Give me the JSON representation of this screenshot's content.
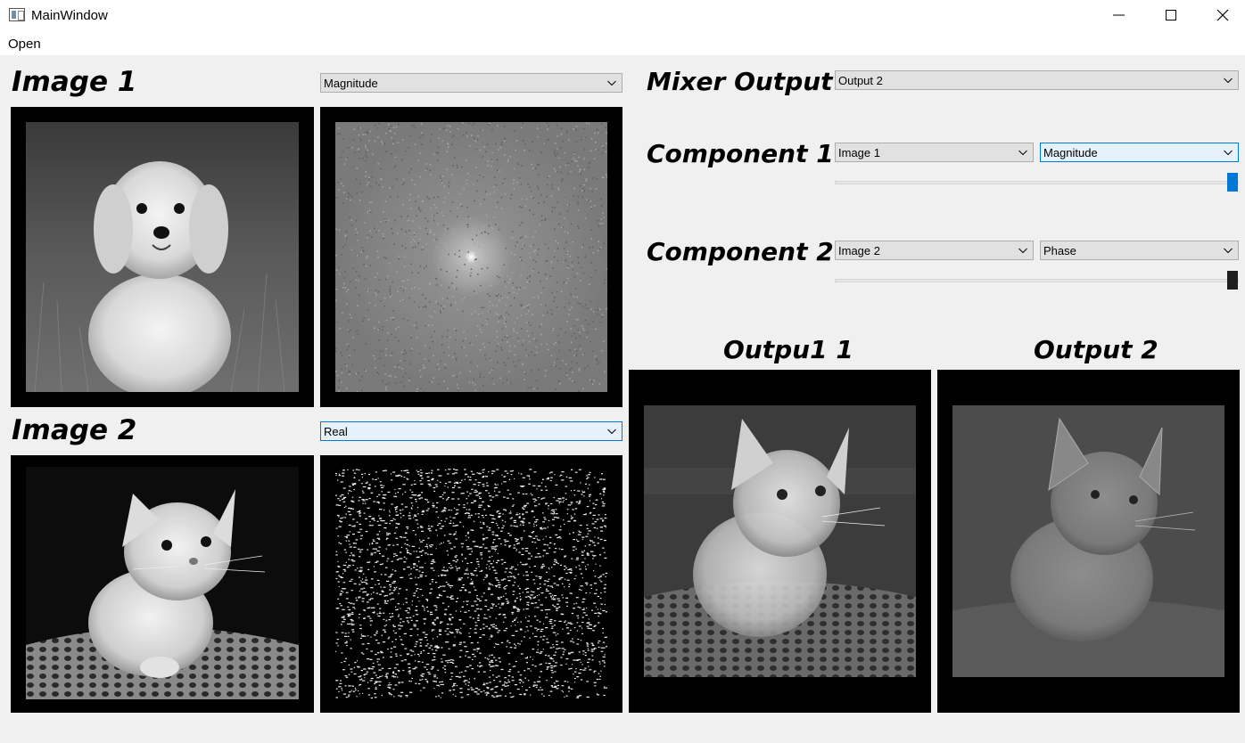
{
  "window": {
    "title": "MainWindow"
  },
  "menu": {
    "open_label": "Open"
  },
  "image1": {
    "heading": "Image 1",
    "component": "Magnitude"
  },
  "image2": {
    "heading": "Image 2",
    "component": "Real"
  },
  "mixer": {
    "heading": "Mixer Output",
    "output_select": "Output 2",
    "component1": {
      "heading": "Component 1",
      "source": "Image 1",
      "type": "Magnitude",
      "slider_value": 1.0
    },
    "component2": {
      "heading": "Component 2",
      "source": "Image 2",
      "type": "Phase",
      "slider_value": 1.0
    }
  },
  "outputs": {
    "output1_heading": "Outpu1 1",
    "output2_heading": "Output 2"
  },
  "colors": {
    "accent": "#0078d7",
    "dark_handle": "#1e1e1e",
    "panel_bg": "#000000"
  }
}
